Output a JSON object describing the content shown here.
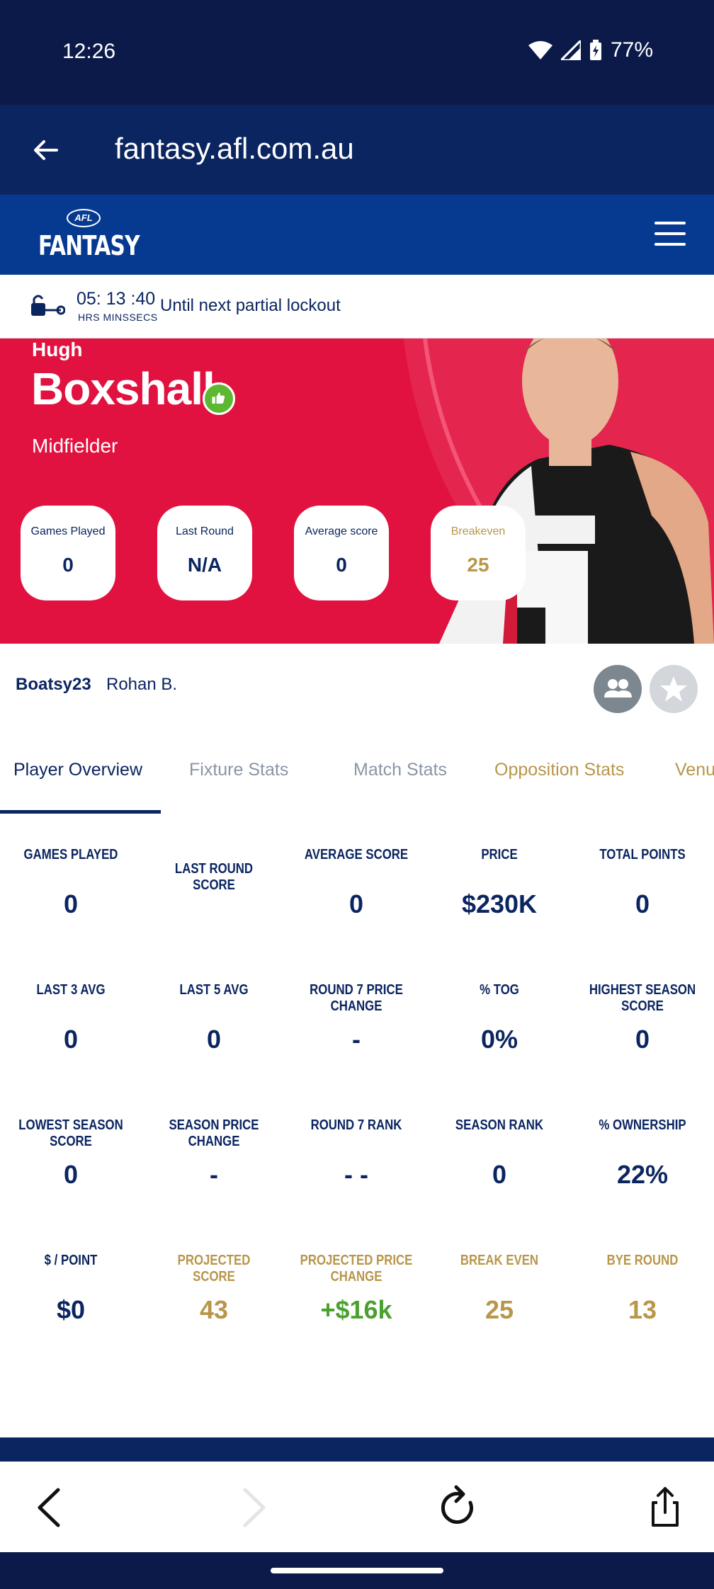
{
  "status_bar": {
    "time": "12:26",
    "battery": "77%"
  },
  "browser": {
    "url": "fantasy.afl.com.au"
  },
  "header": {
    "logo_small": "AFL",
    "logo_main": "FANTASY"
  },
  "lockout": {
    "countdown": "05: 13 :40",
    "units": "HRS MINSSECS",
    "label": "Until next partial lockout"
  },
  "player": {
    "first_name": "Hugh",
    "last_name": "Boxshall",
    "position": "Midfielder",
    "pills": [
      {
        "label": "Games Played",
        "value": "0"
      },
      {
        "label": "Last Round",
        "value": "N/A"
      },
      {
        "label": "Average score",
        "value": "0"
      },
      {
        "label": "Breakeven",
        "value": "25"
      }
    ]
  },
  "owner": {
    "team": "Boatsy23",
    "name": "Rohan B."
  },
  "tabs": [
    "Player Overview",
    "Fixture Stats",
    "Match Stats",
    "Opposition Stats",
    "Venu"
  ],
  "stats": [
    {
      "label": "GAMES PLAYED",
      "value": "0"
    },
    {
      "label": "LAST ROUND SCORE",
      "value": ""
    },
    {
      "label": "AVERAGE SCORE",
      "value": "0"
    },
    {
      "label": "PRICE",
      "value": "$230K"
    },
    {
      "label": "TOTAL POINTS",
      "value": "0"
    },
    {
      "label": "LAST 3 AVG",
      "value": "0"
    },
    {
      "label": "LAST 5 AVG",
      "value": "0"
    },
    {
      "label": "ROUND 7 PRICE CHANGE",
      "value": "-"
    },
    {
      "label": "% TOG",
      "value": "0%"
    },
    {
      "label": "HIGHEST SEASON SCORE",
      "value": "0"
    },
    {
      "label": "LOWEST SEASON SCORE",
      "value": "0"
    },
    {
      "label": "SEASON PRICE CHANGE",
      "value": "-"
    },
    {
      "label": "ROUND 7 RANK",
      "value": "- -"
    },
    {
      "label": "SEASON RANK",
      "value": "0"
    },
    {
      "label": "% OWNERSHIP",
      "value": "22%"
    },
    {
      "label": "$ / POINT",
      "value": "$0"
    },
    {
      "label": "PROJECTED SCORE",
      "value": "43"
    },
    {
      "label": "PROJECTED PRICE CHANGE",
      "value": "+$16k"
    },
    {
      "label": "BREAK EVEN",
      "value": "25"
    },
    {
      "label": "BYE ROUND",
      "value": "13"
    }
  ],
  "colors": {
    "navy": "#0b2560",
    "red": "#e1123f",
    "gold": "#b8964a",
    "green": "#4aa12e"
  }
}
